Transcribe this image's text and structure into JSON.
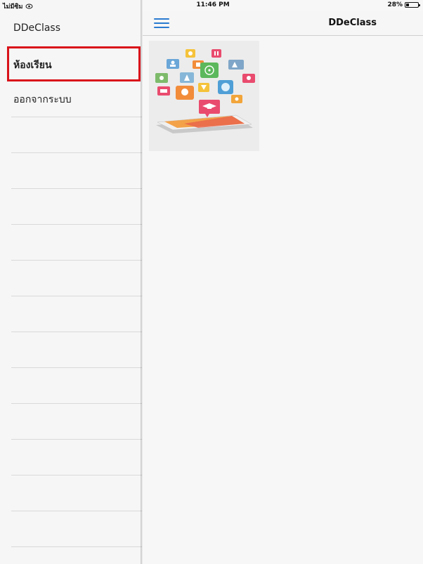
{
  "status": {
    "carrier": "ไม่มีซิม",
    "time": "11:46 PM",
    "battery_text": "28%",
    "battery_level": 0.28
  },
  "sidebar": {
    "title": "DDeClass",
    "items": [
      {
        "label": "ห้องเรียน",
        "selected": true
      },
      {
        "label": "ออกจากระบบ",
        "selected": false
      },
      {
        "label": "",
        "selected": false
      },
      {
        "label": "",
        "selected": false
      },
      {
        "label": "",
        "selected": false
      },
      {
        "label": "",
        "selected": false
      },
      {
        "label": "",
        "selected": false
      },
      {
        "label": "",
        "selected": false
      },
      {
        "label": "",
        "selected": false
      },
      {
        "label": "",
        "selected": false
      },
      {
        "label": "",
        "selected": false
      },
      {
        "label": "",
        "selected": false
      },
      {
        "label": "",
        "selected": false
      },
      {
        "label": "",
        "selected": false
      }
    ]
  },
  "header": {
    "menu_icon": "hamburger-menu-icon",
    "title": "DDeClass"
  },
  "content": {
    "cards": [
      {
        "image": "education-tablet-illustration"
      }
    ]
  },
  "colors": {
    "accent": "#2a7bd0",
    "selection_border": "#d9121a",
    "sidebar_bg": "#f6f6f6"
  }
}
